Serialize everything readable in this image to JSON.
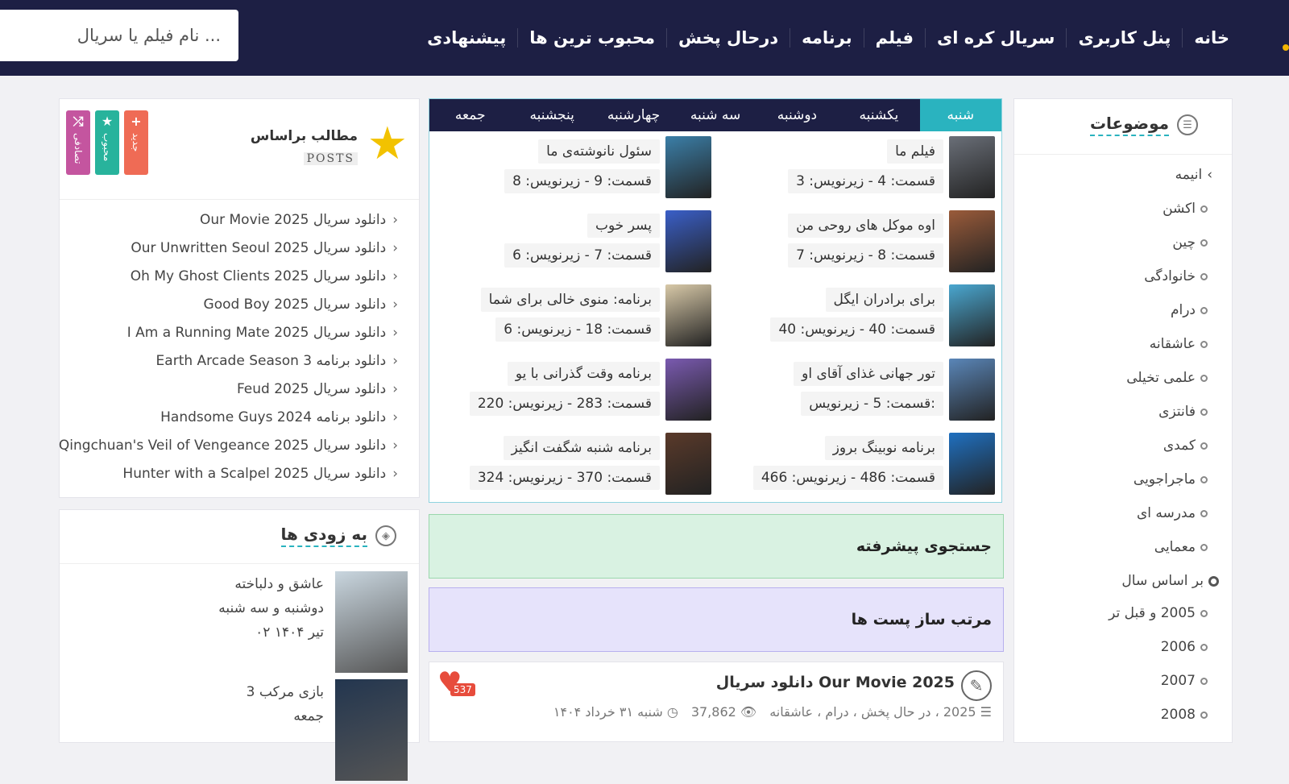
{
  "search": {
    "placeholder": "نام فیلم یا سریال ..."
  },
  "nav": [
    "خانه",
    "پنل کاربری",
    "سریال کره ای",
    "فیلم",
    "برنامه",
    "درحال پخش",
    "محبوب ترین ها",
    "پیشنهادی"
  ],
  "categories": {
    "title": "موضوعات",
    "items": [
      "انیمه",
      "اکشن",
      "چین",
      "خانوادگی",
      "درام",
      "عاشقانه",
      "علمی تخیلی",
      "فانتزی",
      "کمدی",
      "ماجراجویی",
      "مدرسه ای",
      "معمایی",
      "بر اساس سال",
      "2005 و قبل تر",
      "2006",
      "2007",
      "2008"
    ]
  },
  "schedule": {
    "days": [
      "شنبه",
      "یکشنبه",
      "دوشنبه",
      "سه شنبه",
      "چهارشنبه",
      "پنجشنبه",
      "جمعه"
    ],
    "shows": [
      {
        "title": "فیلم ما",
        "episode": "قسمت: 4 - زیرنویس: 3",
        "color": "#6a6f78"
      },
      {
        "title": "سئول نانوشته‌ی ما",
        "episode": "قسمت: 9 - زیرنویس: 8",
        "color": "#3b7fa8"
      },
      {
        "title": "اوه موکل های روحی من",
        "episode": "قسمت: 8 - زیرنویس: 7",
        "color": "#9a5b3a"
      },
      {
        "title": "پسر خوب",
        "episode": "قسمت: 7 - زیرنویس: 6",
        "color": "#3a5fc8"
      },
      {
        "title": "برای برادران ایگل",
        "episode": "قسمت: 40 - زیرنویس: 40",
        "color": "#4aa7d0"
      },
      {
        "title": "برنامه: منوی خالی برای شما",
        "episode": "قسمت: 18 - زیرنویس: 6",
        "color": "#d8c9a8"
      },
      {
        "title": "تور جهانی غذای آقای او",
        "episode": "قسمت: 5 - زیرنویس:",
        "color": "#5a86b8"
      },
      {
        "title": "برنامه وقت گذرانی با یو",
        "episode": "قسمت: 283 - زیرنویس: 220",
        "color": "#7a5ab0"
      },
      {
        "title": "برنامه نوبینگ بروز",
        "episode": "قسمت: 486 - زیرنویس: 466",
        "color": "#1f70c0"
      },
      {
        "title": "برنامه شنبه شگفت انگیز",
        "episode": "قسمت: 370 - زیرنویس: 324",
        "color": "#5a3a2a"
      }
    ]
  },
  "advanced_search": "جستجوی پیشرفته",
  "post_sorter": "مرتب ساز پست ها",
  "post": {
    "title": "دانلود سریال Our Movie 2025",
    "tags": "2025 ، در حال پخش ، درام ، عاشقانه",
    "views": "37,862",
    "date": "شنبه ۳۱ خرداد ۱۴۰۴",
    "likes": "537"
  },
  "posts_box": {
    "label": "مطالب براساس",
    "sub": "POSTS",
    "buttons": [
      {
        "icon": "+",
        "label": "جدید",
        "color": "#ef6b55"
      },
      {
        "icon": "★",
        "label": "محبوب",
        "color": "#28b39c"
      },
      {
        "icon": "⤮",
        "label": "تصادفی",
        "color": "#c4559f"
      }
    ],
    "links": [
      "دانلود سریال Our Movie 2025",
      "دانلود سریال Our Unwritten Seoul 2025",
      "دانلود سریال Oh My Ghost Clients 2025",
      "دانلود سریال Good Boy 2025",
      "دانلود سریال I Am a Running Mate 2025",
      "دانلود برنامه Earth Arcade Season 3",
      "دانلود سریال Feud 2025",
      "دانلود برنامه Handsome Guys 2024",
      "دانلود سریال Qingchuan's Veil of Vengeance 2025",
      "دانلود سریال Hunter with a Scalpel 2025"
    ]
  },
  "soon": {
    "title": "به زودی ها",
    "items": [
      {
        "title": "عاشق و دلباخته",
        "days": "دوشنبه و سه شنبه",
        "date": "۰۲ تیر ۱۴۰۴",
        "color": "#c9d6df"
      },
      {
        "title": "بازی مرکب 3",
        "days": "جمعه",
        "date": "",
        "color": "#23364f"
      }
    ]
  }
}
